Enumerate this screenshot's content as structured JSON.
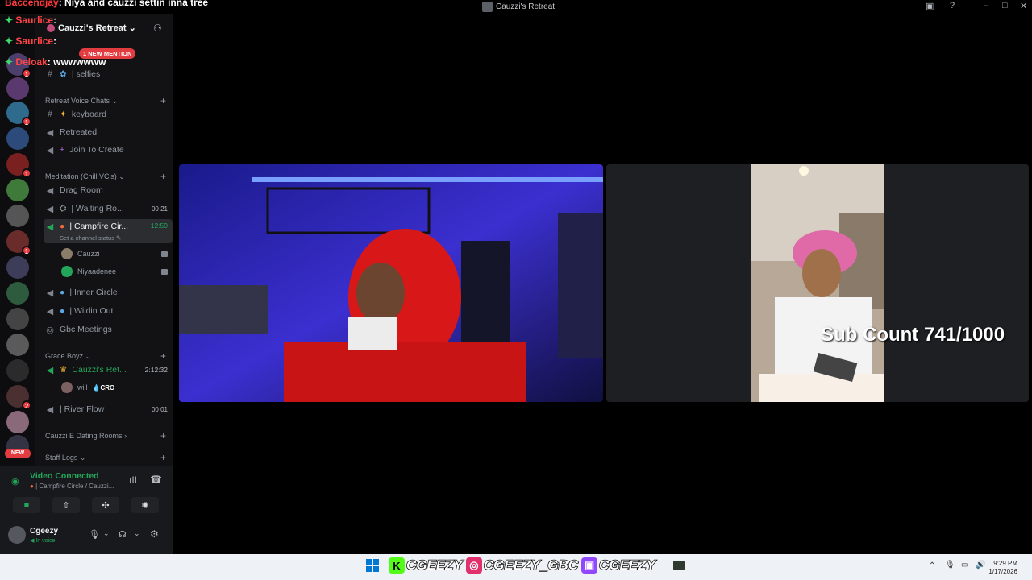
{
  "window": {
    "title": "Cauzzi's Retreat"
  },
  "chat_overlay": {
    "messages": [
      {
        "user": "Baccendjay",
        "sep": ":",
        "text": "Niya and cauzzi settin inna tree",
        "color": "#ff3b3b"
      },
      {
        "user": "Saurlice",
        "sep": ":",
        "text": "",
        "color": "#ff4545"
      },
      {
        "user": "Saurlice",
        "sep": ":",
        "text": "",
        "color": "#ff4545"
      },
      {
        "user": "Deloak",
        "sep": ":",
        "text": "wwwwwww",
        "color": "#ff4545"
      }
    ]
  },
  "server": {
    "name": "Cauzzi's Retreat",
    "mention_pill": "1 NEW MENTION"
  },
  "server_badges": [
    "1",
    "1",
    "1",
    "1",
    "2"
  ],
  "server_new_label": "NEW",
  "channels": {
    "top": [
      {
        "name": "| selfies",
        "icon": "#"
      }
    ],
    "retreat_voice": {
      "label": "Retreat Voice Chats",
      "items": [
        {
          "name": "keyboard",
          "icon": "#"
        },
        {
          "name": "Retreated",
          "icon": "🔊"
        },
        {
          "name": "Join To Create",
          "icon": "🔊"
        }
      ]
    },
    "meditation": {
      "label": "Meditation (Chill VC's)",
      "items": [
        {
          "name": "Drag Room",
          "icon": "🔊"
        },
        {
          "name": "| Waiting Ro...",
          "icon": "🔊",
          "count_a": "00",
          "count_b": "21"
        },
        {
          "name": "| Campfire Cir...",
          "icon": "🔊",
          "time": "12:59",
          "status": "Set a channel status"
        },
        {
          "name": "| Inner Circle",
          "icon": "🔊"
        },
        {
          "name": "| Wildin Out",
          "icon": "🔊"
        },
        {
          "name": "Gbc Meetings",
          "icon": "◎"
        }
      ],
      "members": [
        "Cauzzi",
        "Niyaadenee"
      ]
    },
    "grace_boyz": {
      "label": "Grace Boyz",
      "items": [
        {
          "name": "Cauzzi's Ret...",
          "icon": "🔊",
          "time": "2:12:32"
        },
        {
          "name": "| River Flow",
          "icon": "🔊",
          "count_a": "00",
          "count_b": "01"
        }
      ],
      "member": {
        "name": "will",
        "tag": "CRO"
      }
    },
    "cauzzi_dating": {
      "label": "Cauzzi E Dating Rooms"
    },
    "staff_logs": {
      "label": "Staff Logs"
    }
  },
  "voice_panel": {
    "status": "Video Connected",
    "channel": "| Campfire Circle / Cauzzi...",
    "user": "Cgeezy",
    "user_status": "In voice"
  },
  "stream_overlay": {
    "sub_count": "Sub Count 741/1000"
  },
  "taskbar": {
    "handles": [
      "CGEEZY",
      "CGEEZY_GBC",
      "CGEEZY"
    ],
    "time": "9:29 PM",
    "date": "1/17/2026"
  },
  "colors": {
    "accent_green": "#23a55a",
    "mention_red": "#e23c40",
    "kick_green": "#53fc18",
    "twitch_purple": "#9146ff",
    "instagram_pink": "#e1306c"
  }
}
